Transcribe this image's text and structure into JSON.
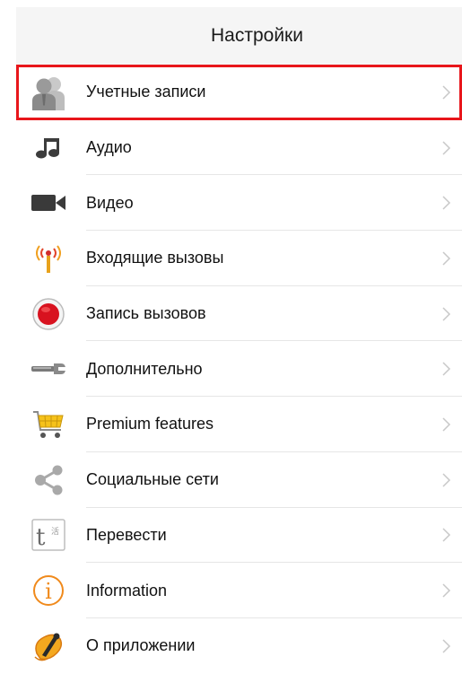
{
  "header": {
    "title": "Настройки"
  },
  "items": [
    {
      "label": "Учетные записи",
      "icon": "accounts-icon"
    },
    {
      "label": "Аудио",
      "icon": "music-note-icon"
    },
    {
      "label": "Видео",
      "icon": "video-camera-icon"
    },
    {
      "label": "Входящие вызовы",
      "icon": "antenna-icon"
    },
    {
      "label": "Запись вызовов",
      "icon": "record-icon"
    },
    {
      "label": "Дополнительно",
      "icon": "wrench-icon"
    },
    {
      "label": "Premium features",
      "icon": "shopping-cart-icon"
    },
    {
      "label": "Социальные сети",
      "icon": "share-icon"
    },
    {
      "label": "Перевести",
      "icon": "translate-icon",
      "icon_text": "t",
      "icon_sub": "活"
    },
    {
      "label": "Information",
      "icon": "info-icon",
      "icon_text": "i"
    },
    {
      "label": "О приложении",
      "icon": "app-logo-icon"
    }
  ],
  "colors": {
    "highlight": "#e8161b",
    "record": "#d8121f",
    "accent_orange": "#f08a1c",
    "cart_yellow": "#f6c21a"
  }
}
